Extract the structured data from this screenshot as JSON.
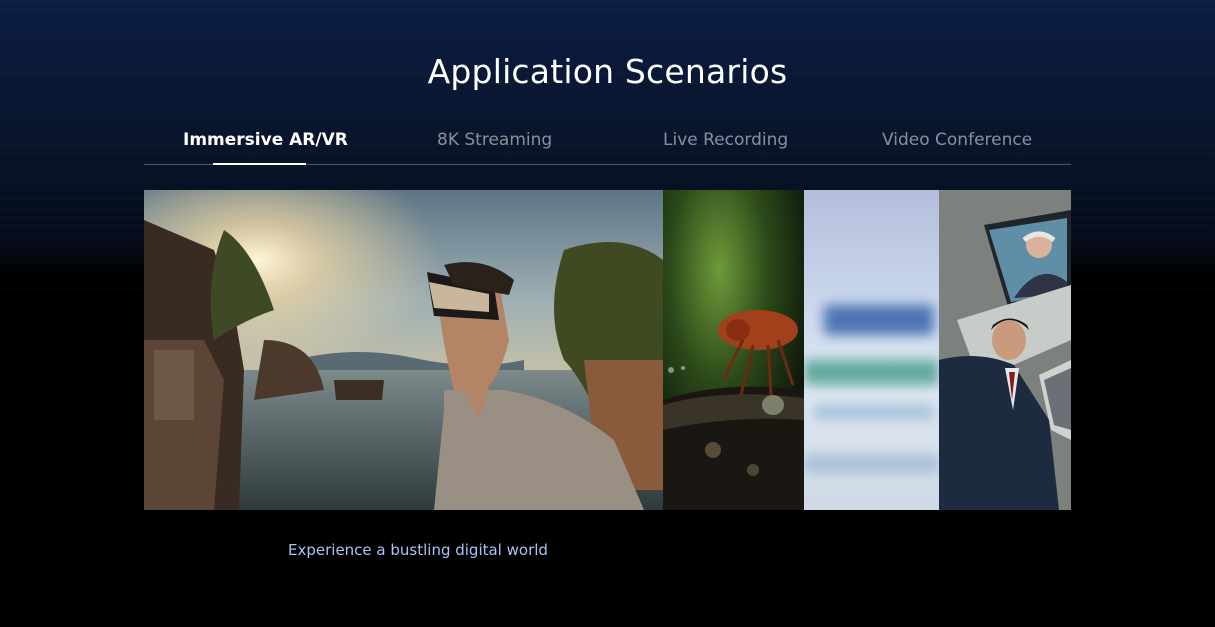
{
  "section": {
    "title": "Application Scenarios"
  },
  "tabs": [
    {
      "label": "Immersive AR/VR",
      "active": true
    },
    {
      "label": "8K Streaming",
      "active": false
    },
    {
      "label": "Live Recording",
      "active": false
    },
    {
      "label": "Video Conference",
      "active": false
    }
  ],
  "panels": [
    {
      "name": "vr-lake-scene"
    },
    {
      "name": "ant-macro-scene"
    },
    {
      "name": "blurred-screen-scene"
    },
    {
      "name": "business-video-call-scene"
    }
  ],
  "caption": "Experience a bustling digital world",
  "colors": {
    "background_top": "#0c1d44",
    "caption": "#a9c3f2",
    "tab_active": "#ffffff",
    "tab_inactive": "#8a8f9c"
  }
}
